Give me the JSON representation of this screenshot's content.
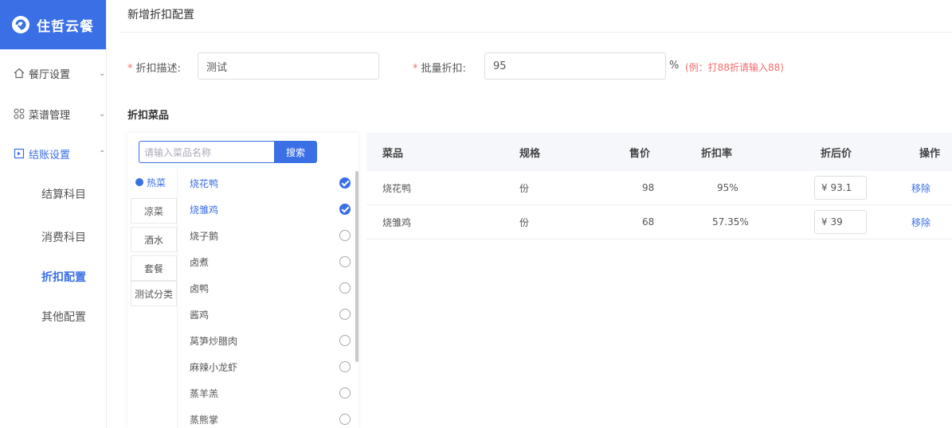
{
  "brand": {
    "name": "住哲云餐"
  },
  "sidebar": {
    "items": [
      {
        "label": "餐厅设置",
        "icon": "home-icon",
        "arrow": "⌄"
      },
      {
        "label": "菜谱管理",
        "icon": "grid-icon",
        "arrow": "⌄"
      },
      {
        "label": "结账设置",
        "icon": "checkout-icon",
        "arrow": "⌃"
      }
    ],
    "subitems": [
      {
        "label": "结算科目"
      },
      {
        "label": "消费科目"
      },
      {
        "label": "折扣配置"
      },
      {
        "label": "其他配置"
      }
    ]
  },
  "page": {
    "title": "新增折扣配置"
  },
  "form": {
    "desc_label": "折扣描述:",
    "desc_value": "测试",
    "batch_label": "批量折扣:",
    "batch_value": "95",
    "percent": "%",
    "hint": "(例：打88折请输入88)",
    "required_mark": "*"
  },
  "section": {
    "title": "折扣菜品"
  },
  "picker": {
    "search_placeholder": "请输入菜品名称",
    "search_button": "搜索",
    "categories": [
      "热菜",
      "凉菜",
      "酒水",
      "套餐",
      "测试分类"
    ],
    "dishes": [
      {
        "name": "烧花鸭",
        "checked": true
      },
      {
        "name": "烧雏鸡",
        "checked": true
      },
      {
        "name": "烧子鹅",
        "checked": false
      },
      {
        "name": "卤煮",
        "checked": false
      },
      {
        "name": "卤鸭",
        "checked": false
      },
      {
        "name": "酱鸡",
        "checked": false
      },
      {
        "name": "莴笋炒腊肉",
        "checked": false
      },
      {
        "name": "麻辣小龙虾",
        "checked": false
      },
      {
        "name": "蒸羊羔",
        "checked": false
      },
      {
        "name": "蒸熊掌",
        "checked": false
      }
    ]
  },
  "table": {
    "headers": [
      "菜品",
      "规格",
      "售价",
      "折扣率",
      "折后价",
      "操作"
    ],
    "rows": [
      {
        "dish": "烧花鸭",
        "spec": "份",
        "price": "98",
        "rate": "95%",
        "final": "¥ 93.1",
        "action": "移除"
      },
      {
        "dish": "烧雏鸡",
        "spec": "份",
        "price": "68",
        "rate": "57.35%",
        "final": "¥ 39",
        "action": "移除"
      }
    ]
  },
  "colors": {
    "accent": "#3a6fe6",
    "required": "#f56c6c"
  }
}
